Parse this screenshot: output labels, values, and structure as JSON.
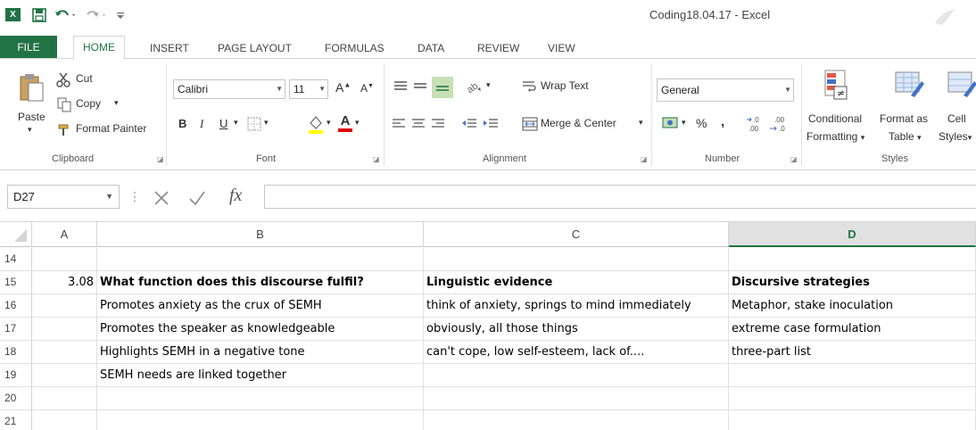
{
  "window": {
    "title": "Coding18.04.17 - Excel",
    "app_logo": "X"
  },
  "tabs": [
    {
      "label": "FILE"
    },
    {
      "label": "HOME"
    },
    {
      "label": "INSERT"
    },
    {
      "label": "PAGE LAYOUT"
    },
    {
      "label": "FORMULAS"
    },
    {
      "label": "DATA"
    },
    {
      "label": "REVIEW"
    },
    {
      "label": "VIEW"
    }
  ],
  "ribbon": {
    "clipboard": {
      "paste": "Paste",
      "cut": "Cut",
      "copy": "Copy",
      "format_painter": "Format Painter",
      "label": "Clipboard"
    },
    "font": {
      "font_name": "Calibri",
      "font_size": "11",
      "bold": "B",
      "italic": "I",
      "underline": "U",
      "font_color_glyph": "A",
      "grow_glyph": "A",
      "shrink_glyph": "A",
      "label": "Font"
    },
    "alignment": {
      "wrap_text": "Wrap Text",
      "merge_center": "Merge & Center",
      "label": "Alignment"
    },
    "number": {
      "format": "General",
      "percent": "%",
      "comma": ",",
      "label": "Number"
    },
    "styles": {
      "conditional_1": "Conditional",
      "conditional_2": "Formatting",
      "format_as_1": "Format as",
      "format_as_2": "Table",
      "cell_1": "Cell",
      "cell_2": "Styles",
      "label": "Styles"
    }
  },
  "formula_bar": {
    "name_box": "D27",
    "fx": "fx",
    "content": ""
  },
  "columns": [
    "A",
    "B",
    "C",
    "D"
  ],
  "rows": [
    {
      "num": "14",
      "a": "",
      "b": "",
      "c": "",
      "d": "",
      "bold": false
    },
    {
      "num": "15",
      "a": "3.08",
      "b": "What function does this discourse fulfil?",
      "c": "Linguistic evidence",
      "d": "Discursive strategies",
      "bold": true
    },
    {
      "num": "16",
      "a": "",
      "b": "Promotes anxiety as the crux of SEMH",
      "c": "think of anxiety, springs to mind immediately",
      "d": "Metaphor, stake inoculation",
      "bold": false
    },
    {
      "num": "17",
      "a": "",
      "b": "Promotes the speaker as knowledgeable",
      "c": "obviously, all those things",
      "d": "extreme case formulation",
      "bold": false
    },
    {
      "num": "18",
      "a": "",
      "b": "Highlights SEMH in a negative tone",
      "c": "can't cope, low self-esteem, lack of....",
      "d": "three-part list",
      "bold": false
    },
    {
      "num": "19",
      "a": "",
      "b": "SEMH needs are linked together",
      "c": "",
      "d": "",
      "bold": false
    },
    {
      "num": "20",
      "a": "",
      "b": "",
      "c": "",
      "d": "",
      "bold": false
    },
    {
      "num": "21",
      "a": "",
      "b": "",
      "c": "",
      "d": "",
      "bold": false
    }
  ],
  "colors": {
    "excel_green": "#217346",
    "selected_header": "#e1e1e1"
  }
}
